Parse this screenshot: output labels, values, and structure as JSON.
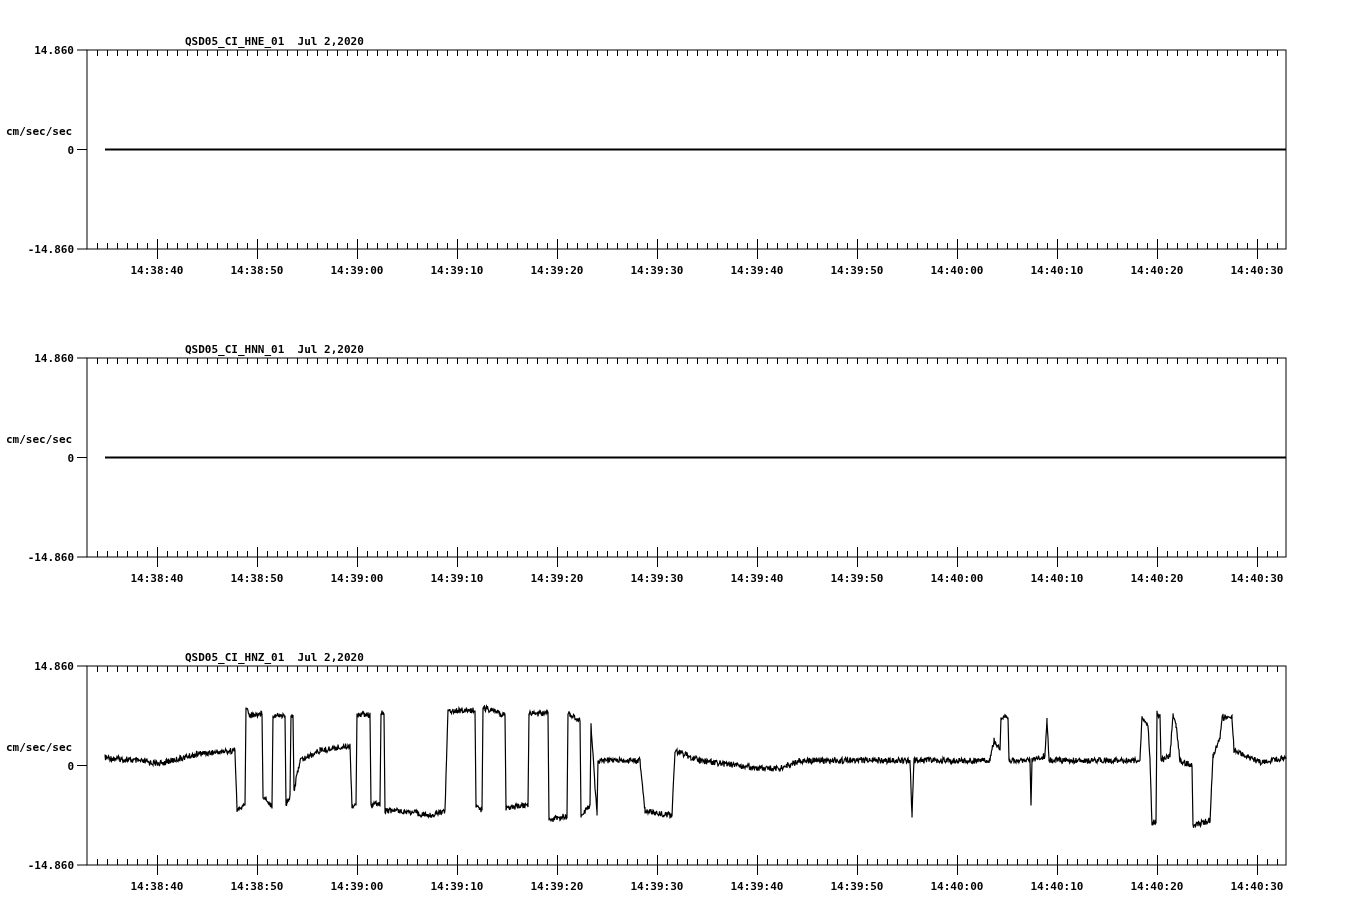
{
  "plots": [
    {
      "title": "QSD05_CI_HNE_01  Jul 2,2020",
      "ylabel": "cm/sec/sec",
      "yticks": [
        "14.860",
        "0",
        "-14.860"
      ],
      "xticks": [
        "14:38:40",
        "14:38:50",
        "14:39:00",
        "14:39:10",
        "14:39:20",
        "14:39:30",
        "14:39:40",
        "14:39:50",
        "14:40:00",
        "14:40:10",
        "14:40:20",
        "14:40:30"
      ],
      "trace": {
        "kind": "flat"
      }
    },
    {
      "title": "QSD05_CI_HNN_01  Jul 2,2020",
      "ylabel": "cm/sec/sec",
      "yticks": [
        "14.860",
        "0",
        "-14.860"
      ],
      "xticks": [
        "14:38:40",
        "14:38:50",
        "14:39:00",
        "14:39:10",
        "14:39:20",
        "14:39:30",
        "14:39:40",
        "14:39:50",
        "14:40:00",
        "14:40:10",
        "14:40:20",
        "14:40:30"
      ],
      "trace": {
        "kind": "flat"
      }
    },
    {
      "title": "QSD05_CI_HNZ_01  Jul 2,2020",
      "ylabel": "cm/sec/sec",
      "yticks": [
        "14.860",
        "0",
        "-14.860"
      ],
      "xticks": [
        "14:38:40",
        "14:38:50",
        "14:39:00",
        "14:39:10",
        "14:39:20",
        "14:39:30",
        "14:39:40",
        "14:39:50",
        "14:40:00",
        "14:40:10",
        "14:40:20",
        "14:40:30"
      ],
      "trace": {
        "kind": "waveform"
      }
    }
  ]
}
